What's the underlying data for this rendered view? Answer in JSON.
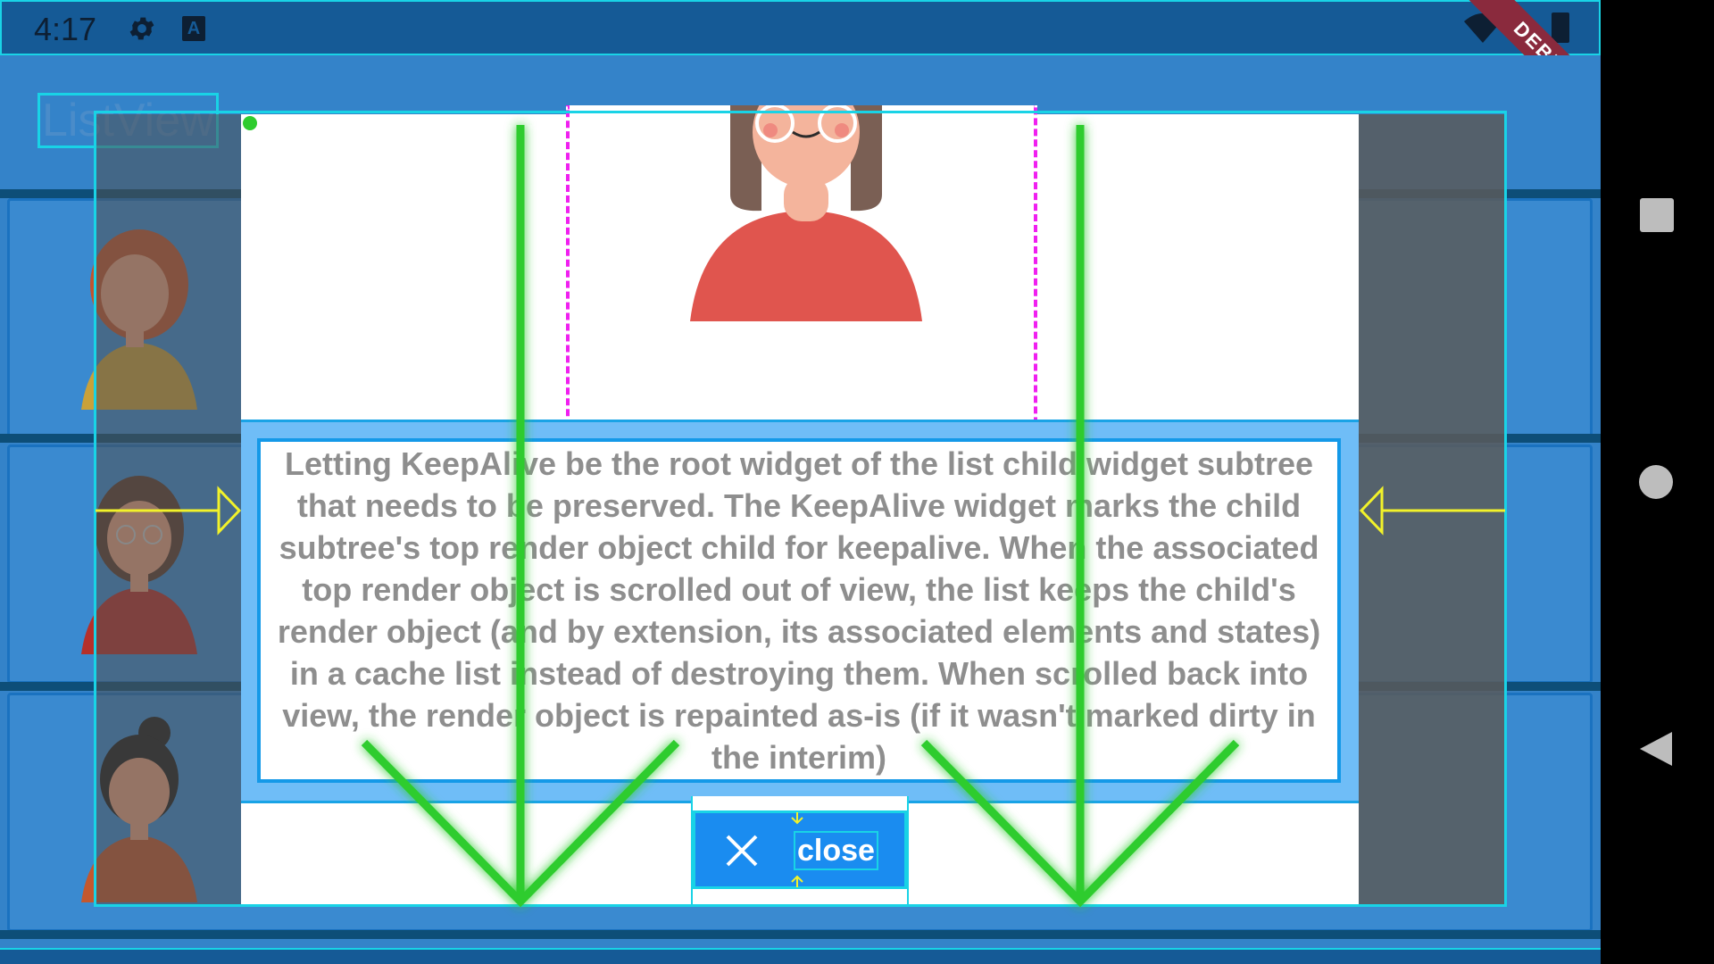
{
  "status_bar": {
    "time": "4:17",
    "icons": [
      "gear-icon",
      "a-icon",
      "wifi-icon",
      "battery-icon"
    ],
    "a_label": "A"
  },
  "debug_banner": "DEBUG",
  "app_bar": {
    "title": "ListView"
  },
  "list": {
    "items": [
      {
        "avatar": "avatar-red-hair-icon"
      },
      {
        "avatar": "avatar-glasses-icon"
      },
      {
        "avatar": "avatar-bun-hair-icon"
      }
    ]
  },
  "dialog": {
    "image": "woman-with-glasses-portrait",
    "description": "Letting KeepAlive be the root widget of the list child widget subtree that needs to be preserved. The KeepAlive widget marks the child subtree's top render object child for keepalive. When the associated top render object is scrolled out of view, the list keeps the child's render object (and by extension, its associated elements and states) in a cache list instead of destroying them. When scrolled back into view, the render object is repainted as-is (if it wasn't marked dirty in the interim)",
    "close_label": "close",
    "close_icon": "close-icon"
  },
  "nav_bar": {
    "buttons": [
      "recents-button",
      "home-button",
      "back-button"
    ]
  },
  "colors": {
    "status_bar": "#155a96",
    "background": "#3483c9",
    "accent": "#1a8cf0",
    "outline": "#19d3e6",
    "dashed_border": "#f01ff0",
    "arrow_green": "#2ecc2e",
    "arrow_yellow": "#f2f22a",
    "debug": "#8a2a3d"
  }
}
